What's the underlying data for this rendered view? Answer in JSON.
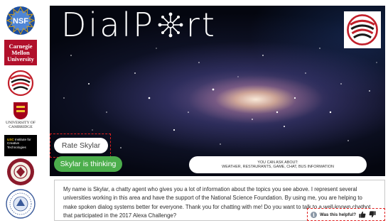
{
  "sidebar": {
    "logos": [
      {
        "name": "nsf-logo",
        "text": "NSF"
      },
      {
        "name": "carnegie-mellon-logo",
        "lines": [
          "Carnegie",
          "Mellon",
          "University"
        ]
      },
      {
        "name": "dialport-signal-logo"
      },
      {
        "name": "cambridge-logo",
        "lines": [
          "UNIVERSITY OF",
          "CAMBRIDGE"
        ]
      },
      {
        "name": "usc-ict-logo",
        "text_a": "USC",
        "text_b": "Institute for Creative Technologies"
      },
      {
        "name": "university-seal-1"
      },
      {
        "name": "university-seal-2"
      }
    ]
  },
  "header": {
    "brand_left": "DialP",
    "brand_right": "rt"
  },
  "controls": {
    "rate_label": "Rate Skylar",
    "thinking_label": "Skylar is thinking",
    "topics_title": "YOU CAN ASK ABOUT:",
    "topics_list": "WEATHER, RESTAURANTS, GAME, CHAT, BUS INFORMATION"
  },
  "transcript": {
    "message": "My name is Skylar, a chatty agent who gives you a lot of information about the topics you see above. I represent several universities working in this area and have the support of the National Science Foundation. By using me, you are helping to make spoken dialog systems better for everyone. Thank you for chatting with me! Do you want to talk to a well-known chatbot that participated in the 2017 Alexa Challenge?"
  },
  "feedback": {
    "info_glyph": "i",
    "question": "Was this helpful?",
    "thumbs_up_icon": "thumbs-up-icon",
    "thumbs_down_icon": "thumbs-down-icon"
  },
  "colors": {
    "accent_green": "#4cae4c",
    "highlight_red": "#e02020",
    "cmu_red": "#b1102b",
    "nsf_blue": "#1c4fa1"
  }
}
